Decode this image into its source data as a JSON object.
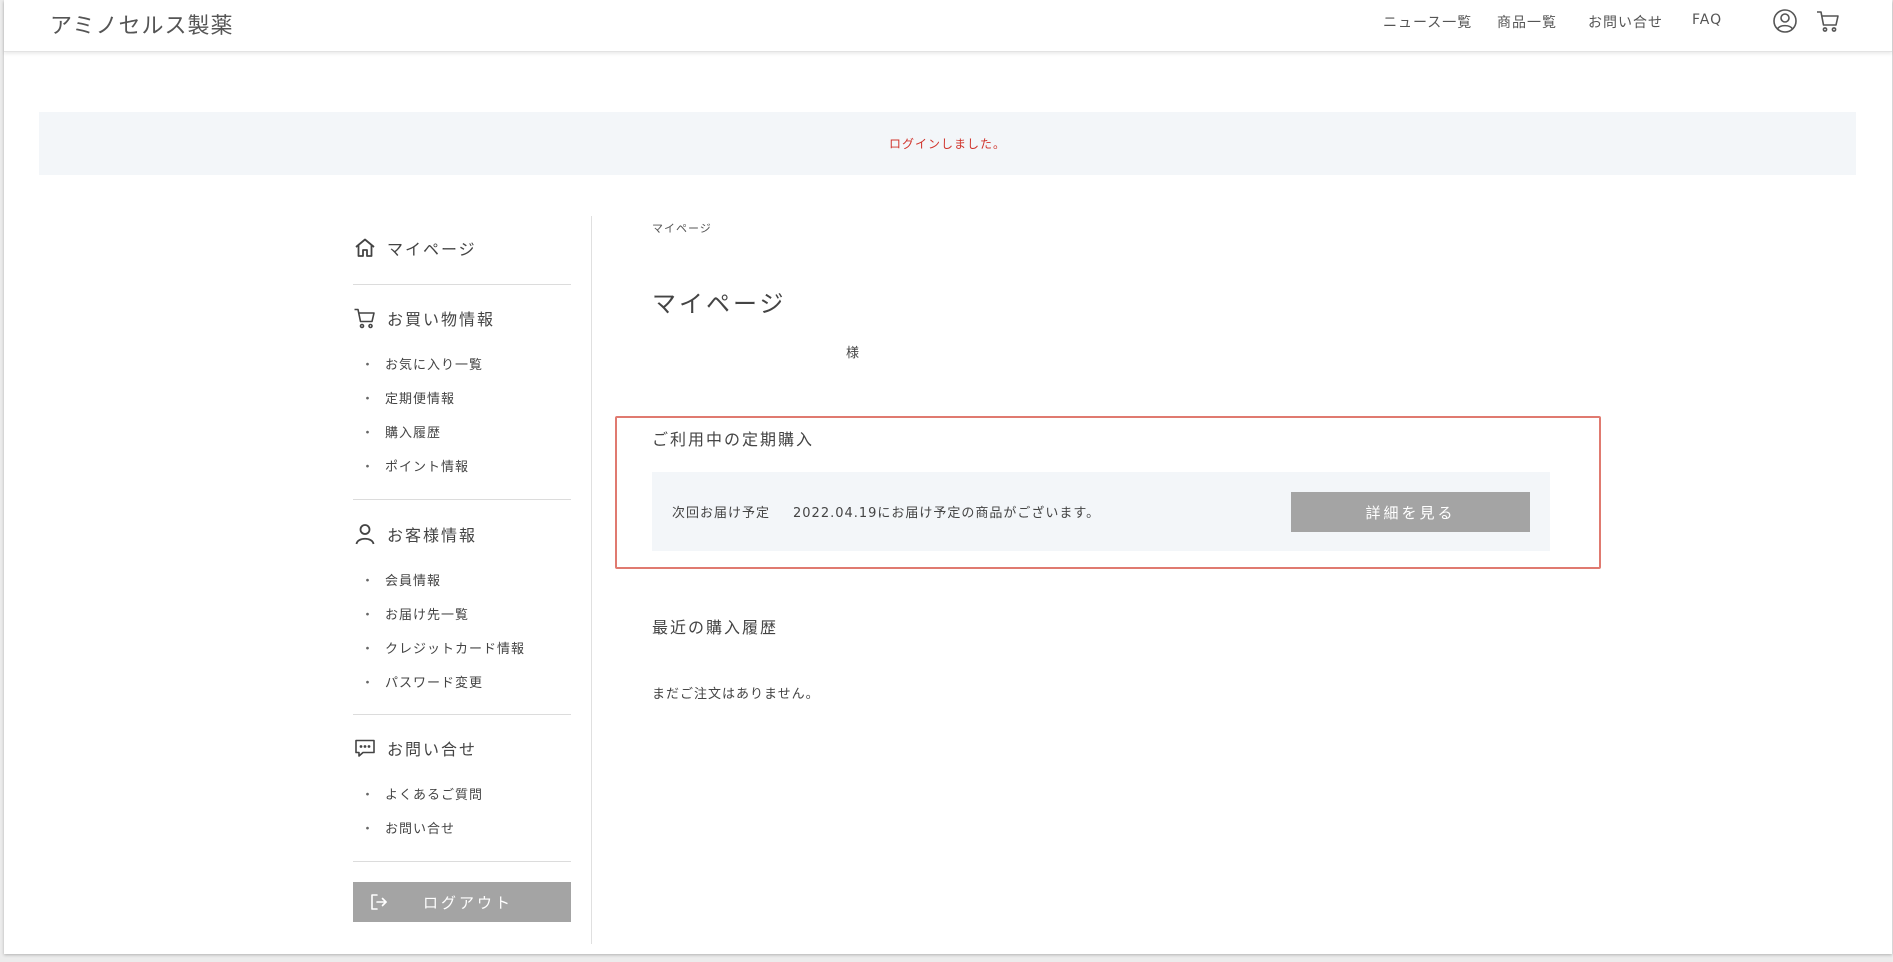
{
  "header": {
    "logo": "アミノセルス製薬",
    "nav": [
      "ニュース一覧",
      "商品一覧",
      "お問い合せ",
      "FAQ"
    ],
    "icons": [
      "user-icon",
      "cart-icon"
    ]
  },
  "flash": {
    "message": "ログインしました。"
  },
  "sidebar": {
    "home_label": "マイページ",
    "shopping": {
      "title": "お買い物情報",
      "items": [
        "お気に入り一覧",
        "定期便情報",
        "購入履歴",
        "ポイント情報"
      ]
    },
    "customer": {
      "title": "お客様情報",
      "items": [
        "会員情報",
        "お届け先一覧",
        "クレジットカード情報",
        "パスワード変更"
      ]
    },
    "inquiry": {
      "title": "お問い合せ",
      "items": [
        "よくあるご質問",
        "お問い合せ"
      ]
    },
    "logout_label": "ログアウト"
  },
  "main": {
    "breadcrumb": "マイページ",
    "title": "マイページ",
    "user_suffix": "様",
    "subscription": {
      "title": "ご利用中の定期購入",
      "label": "次回お届け予定",
      "text": "2022.04.19にお届け予定の商品がございます。",
      "button": "詳細を見る"
    },
    "history": {
      "title": "最近の購入履歴",
      "empty": "まだご注文はありません。"
    }
  },
  "colors": {
    "flash_text": "#d0342c",
    "highlight_border": "#e07a70",
    "button_bg": "#a4a4a4",
    "panel_bg": "#f3f6f9"
  }
}
